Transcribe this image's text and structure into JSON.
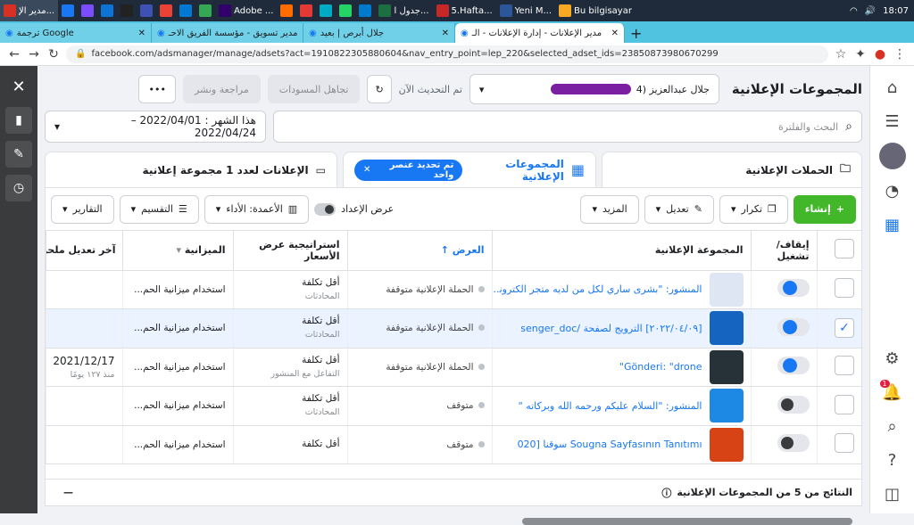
{
  "taskbar": {
    "apps": [
      {
        "label": "مدير الإ...",
        "color": "#d93025",
        "active": true
      },
      {
        "label": "",
        "color": "#1877f2"
      },
      {
        "label": "",
        "color": "#7c4dff"
      },
      {
        "label": "",
        "color": "#0b74d6"
      },
      {
        "label": "",
        "color": "#222222"
      },
      {
        "label": "",
        "color": "#3f51b5"
      },
      {
        "label": "",
        "color": "#ea4335"
      },
      {
        "label": "",
        "color": "#0078d4"
      },
      {
        "label": "",
        "color": "#34a853"
      },
      {
        "label": "Adobe ...",
        "color": "#31006a"
      },
      {
        "label": "",
        "color": "#ff6d00"
      },
      {
        "label": "",
        "color": "#e53935"
      },
      {
        "label": "",
        "color": "#00acc1"
      },
      {
        "label": "",
        "color": "#25d366"
      },
      {
        "label": "",
        "color": "#007acc"
      },
      {
        "label": "جدول ا...",
        "color": "#1d6f42"
      },
      {
        "label": "5.Hafta...",
        "color": "#c62828"
      },
      {
        "label": "Yeni M...",
        "color": "#2b579a"
      },
      {
        "label": "Bu bilgisayar",
        "color": "#f9a825"
      }
    ],
    "time": "18:07"
  },
  "tabs": [
    {
      "label": "ترجمة Google",
      "active": false
    },
    {
      "label": "مدير تسويق - مؤسسة الفريق الاحـ",
      "active": false
    },
    {
      "label": "جلال أبرص | بعيد",
      "active": false
    },
    {
      "label": "مدير الإعلانات - إدارة الإعلانات - الـ",
      "active": true
    }
  ],
  "address": {
    "url": "facebook.com/adsmanager/manage/adsets?act=1910822305880604&nav_entry_point=lep_220&selected_adset_ids=23850873980670299"
  },
  "header": {
    "title": "المجموعات الإعلانية",
    "account": "جلال عبدالعزيز (4",
    "refresh_label": "تم التحديث الآن",
    "discard_label": "تجاهل المسودات",
    "review_label": "مراجعة ونشر"
  },
  "search": {
    "placeholder": "البحث والفلترة"
  },
  "date": {
    "label": "هذا الشهر : 2022/04/01 – 2022/04/24"
  },
  "nav_tabs": {
    "campaigns": "الحملات الإعلانية",
    "adsets": "المجموعات الإعلانية",
    "selected_chip": "تم تحديد عنصر واحد",
    "ads": "الإعلانات لعدد 1 مجموعة إعلانية"
  },
  "toolbar": {
    "create": "إنشاء",
    "duplicate": "تكرار",
    "edit": "تعديل",
    "more": "المزيد",
    "show_setup": "عرض الإعداد",
    "columns": "الأعمدة: الأداء",
    "breakdown": "التقسيم",
    "reports": "التقارير"
  },
  "columns": {
    "toggle": "إيقاف/ تشغيل",
    "adset": "المجموعة الإعلانية",
    "delivery": "العرض",
    "bid_strategy": "استراتيجية عرض الأسعار",
    "budget": "الميزانية",
    "last_edit": "آخر تعديل ملحو"
  },
  "rows": [
    {
      "on": true,
      "selected": false,
      "thumb": "#dfe6f3",
      "name": "المنشور: \"بشرى ساري لكل من لديه متجر الكتروني ...",
      "delivery": "الحملة الإعلانية متوقفة",
      "bid": "أقل تكلفة",
      "bid_sub": "المحادثات",
      "budget": "استخدام ميزانية الحم...",
      "last": "",
      "last_sub": ""
    },
    {
      "on": true,
      "selected": true,
      "thumb": "#1565c0",
      "name": "[٢٠٢٢/٠٤/٠٩] الترويج لصفحة /senger_doc",
      "delivery": "الحملة الإعلانية متوقفة",
      "bid": "أقل تكلفة",
      "bid_sub": "المحادثات",
      "budget": "استخدام ميزانية الحم...",
      "last": "",
      "last_sub": ""
    },
    {
      "on": true,
      "selected": false,
      "thumb": "#263238",
      "name": "Gönderi: \"drone\"",
      "delivery": "الحملة الإعلانية متوقفة",
      "bid": "أقل تكلفة",
      "bid_sub": "التفاعل مع المنشور",
      "budget": "استخدام ميزانية الحم...",
      "last": "2021/12/17",
      "last_sub": "منذ ١٢٧ يومًا"
    },
    {
      "on": false,
      "selected": false,
      "thumb": "#1e88e5",
      "name": "المنشور: \"السلام عليكم ورحمه الله وبركاته \"",
      "delivery": "متوقف",
      "bid": "أقل تكلفة",
      "bid_sub": "المحادثات",
      "budget": "استخدام ميزانية الحم...",
      "last": "",
      "last_sub": ""
    },
    {
      "on": false,
      "selected": false,
      "thumb": "#d84315",
      "name": "Sougna Sayfasının Tanıtımı سوقنا [020",
      "delivery": "متوقف",
      "bid": "أقل تكلفة",
      "bid_sub": "",
      "budget": "استخدام ميزانية الحم...",
      "last": "",
      "last_sub": ""
    }
  ],
  "footer": {
    "results": "النتائج من 5 من المجموعات الإعلانية",
    "dash": "—"
  }
}
